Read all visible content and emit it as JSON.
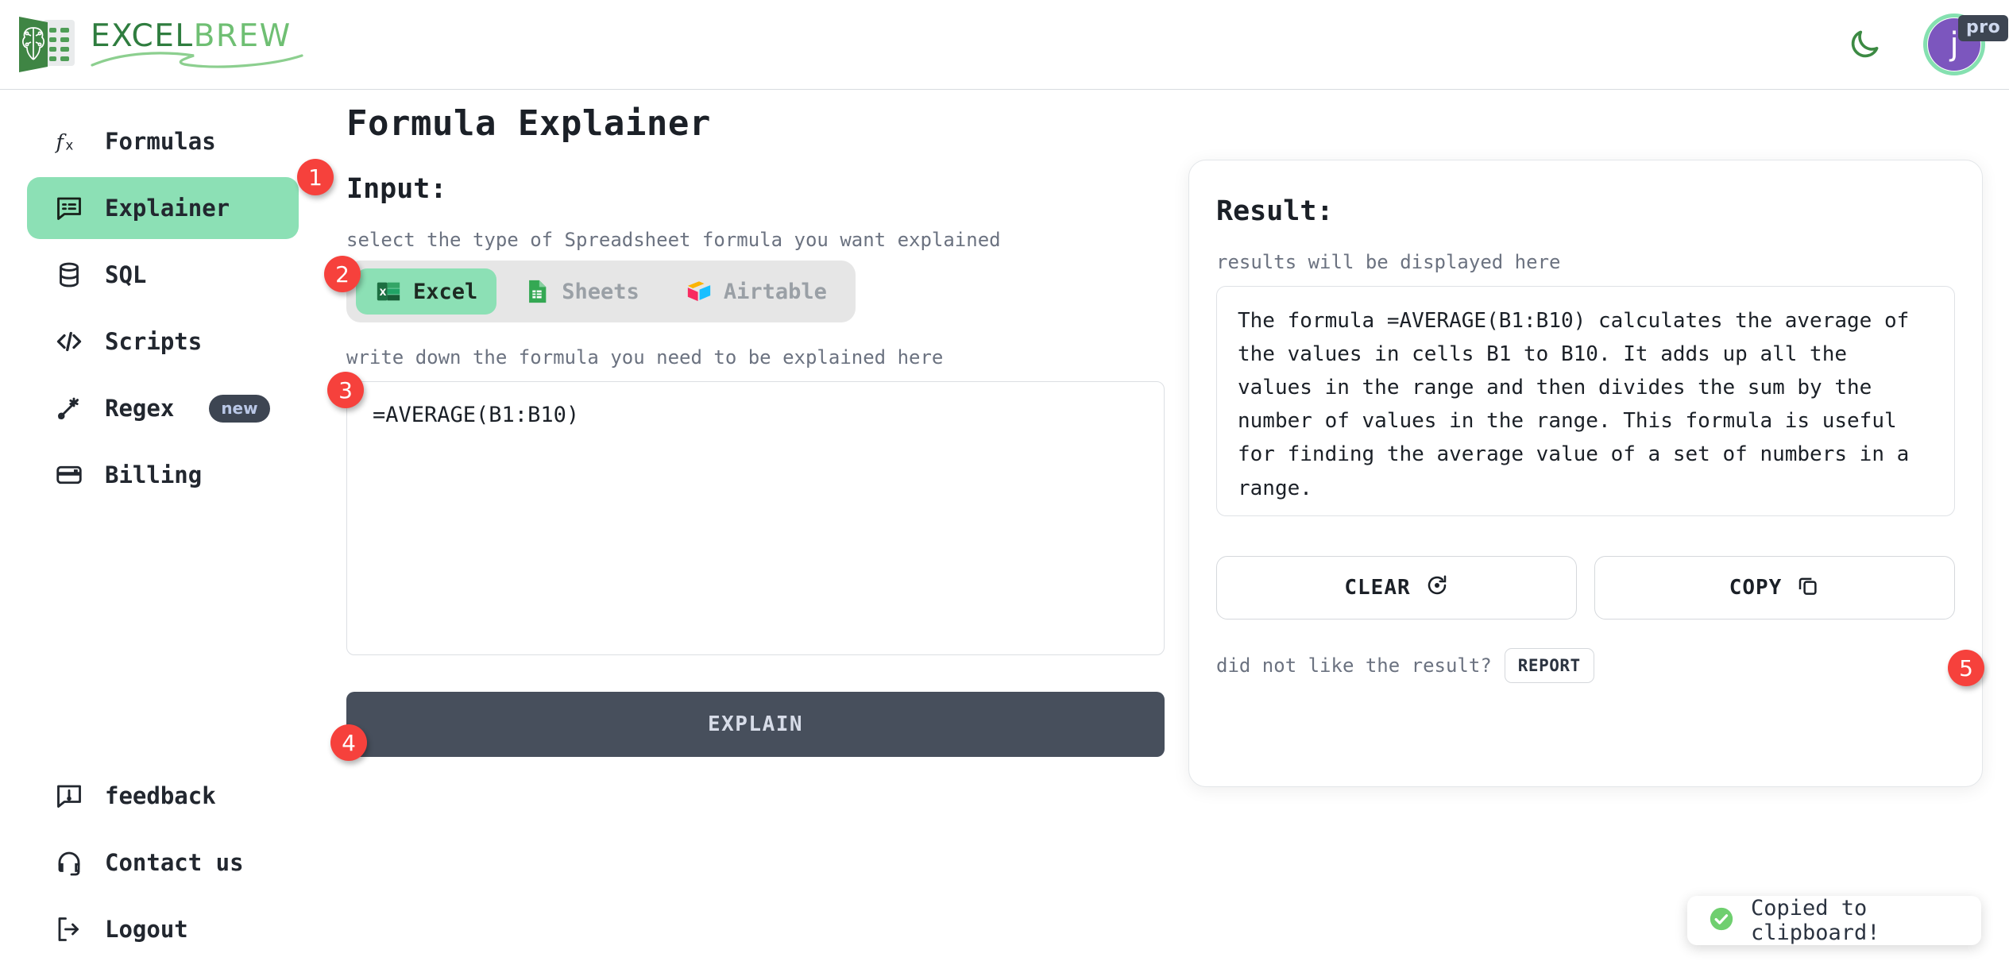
{
  "brand": {
    "name_part1": "EXCEL",
    "name_part2": "BREW",
    "logo_icon": "brain-spreadsheet-logo",
    "colors": {
      "dark_green": "#2f7d3f",
      "light_green": "#6fbf73",
      "accent_mint": "#8ce0b5",
      "badge_red": "#f6413c",
      "dark_slate": "#474f5c"
    }
  },
  "header": {
    "theme_toggle_icon": "moon-icon",
    "avatar_initial": "j",
    "pro_badge": "pro"
  },
  "sidebar": {
    "items": [
      {
        "label": "Formulas",
        "icon": "fx-icon",
        "active": false,
        "badge": null
      },
      {
        "label": "Explainer",
        "icon": "speech-list-icon",
        "active": true,
        "badge": null
      },
      {
        "label": "SQL",
        "icon": "database-icon",
        "active": false,
        "badge": null
      },
      {
        "label": "Scripts",
        "icon": "code-brackets-icon",
        "active": false,
        "badge": null
      },
      {
        "label": "Regex",
        "icon": "regex-icon",
        "active": false,
        "badge": "new"
      },
      {
        "label": "Billing",
        "icon": "credit-card-icon",
        "active": false,
        "badge": null
      }
    ],
    "bottom_items": [
      {
        "label": "feedback",
        "icon": "feedback-speech-icon"
      },
      {
        "label": "Contact us",
        "icon": "headset-icon"
      },
      {
        "label": "Logout",
        "icon": "logout-arrow-icon"
      }
    ]
  },
  "main": {
    "page_title": "Formula Explainer",
    "input": {
      "heading": "Input:",
      "type_hint": "select the type of Spreadsheet formula you want explained",
      "options": [
        {
          "label": "Excel",
          "icon": "excel-icon",
          "selected": true
        },
        {
          "label": "Sheets",
          "icon": "google-sheets-icon",
          "selected": false
        },
        {
          "label": "Airtable",
          "icon": "airtable-icon",
          "selected": false
        }
      ],
      "formula_hint": "write down the formula you need to be explained here",
      "formula_value": "=AVERAGE(B1:B10)",
      "formula_placeholder": "",
      "submit_label": "EXPLAIN"
    },
    "result": {
      "heading": "Result:",
      "hint": "results will be displayed here",
      "text": "The formula =AVERAGE(B1:B10) calculates the average of the values in cells B1 to B10. It adds up all the values in the range and then divides the sum by the number of values in the range. This formula is useful for finding the average value of a set of numbers in a range.",
      "clear_label": "CLEAR",
      "clear_icon": "reset-circular-arrow-icon",
      "copy_label": "COPY",
      "copy_icon": "copy-squares-icon",
      "report_question": "did not like the result?",
      "report_label": "REPORT"
    }
  },
  "toast": {
    "message": "Copied to clipboard!",
    "icon": "check-circle-icon",
    "color": "#6fcf6f"
  },
  "steps": [
    {
      "number": "1"
    },
    {
      "number": "2"
    },
    {
      "number": "3"
    },
    {
      "number": "4"
    },
    {
      "number": "5"
    }
  ]
}
